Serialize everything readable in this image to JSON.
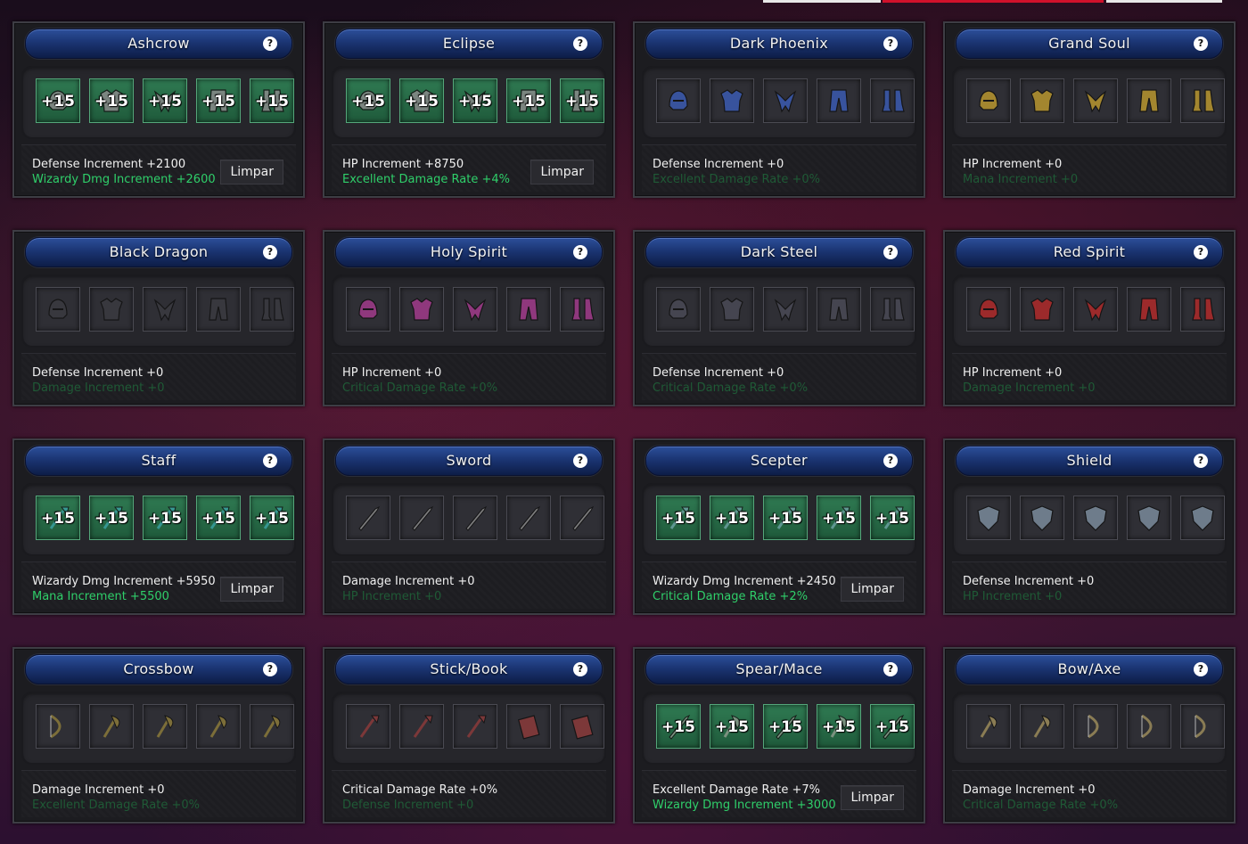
{
  "cards": [
    {
      "title": "Ashcrow",
      "active": true,
      "stat1": "Defense Increment +2100",
      "stat2": "Wizardy Dmg Increment +2600",
      "button": "Limpar",
      "level": "+15",
      "items": [
        "helm",
        "armor",
        "gloves",
        "pants",
        "boots"
      ],
      "color": "#8a8a8a"
    },
    {
      "title": "Eclipse",
      "active": true,
      "stat1": "HP Increment +8750",
      "stat2": "Excellent Damage Rate +4%",
      "button": "Limpar",
      "level": "+15",
      "items": [
        "helm",
        "armor",
        "gloves",
        "pants",
        "boots"
      ],
      "color": "#8a8a8a"
    },
    {
      "title": "Dark Phoenix",
      "active": false,
      "stat1": "Defense Increment +0",
      "stat2": "Excellent Damage Rate +0%",
      "button": "",
      "level": "",
      "items": [
        "helm",
        "armor",
        "gloves",
        "pants",
        "boots"
      ],
      "color": "#3a5ab0"
    },
    {
      "title": "Grand Soul",
      "active": false,
      "stat1": "HP Increment +0",
      "stat2": "Mana Increment +0",
      "button": "",
      "level": "",
      "items": [
        "helm",
        "armor",
        "gloves",
        "pants",
        "boots"
      ],
      "color": "#b8962e"
    },
    {
      "title": "Black Dragon",
      "active": false,
      "stat1": "Defense Increment +0",
      "stat2": "Damage Increment +0",
      "button": "",
      "level": "",
      "items": [
        "helm",
        "armor",
        "gloves",
        "pants",
        "boots"
      ],
      "color": "#3a3a40"
    },
    {
      "title": "Holy Spirit",
      "active": false,
      "stat1": "HP Increment +0",
      "stat2": "Critical Damage Rate +0%",
      "button": "",
      "level": "",
      "items": [
        "helm",
        "armor",
        "gloves",
        "pants",
        "boots"
      ],
      "color": "#a03a8a"
    },
    {
      "title": "Dark Steel",
      "active": false,
      "stat1": "Defense Increment +0",
      "stat2": "Critical Damage Rate +0%",
      "button": "",
      "level": "",
      "items": [
        "helm",
        "armor",
        "gloves",
        "pants",
        "boots"
      ],
      "color": "#4a4a55"
    },
    {
      "title": "Red Spirit",
      "active": false,
      "stat1": "HP Increment +0",
      "stat2": "Damage Increment +0",
      "button": "",
      "level": "",
      "items": [
        "helm",
        "armor",
        "gloves",
        "pants",
        "boots"
      ],
      "color": "#b02a2a"
    },
    {
      "title": "Staff",
      "active": true,
      "stat1": "Wizardy Dmg Increment +5950",
      "stat2": "Mana Increment +5500",
      "button": "Limpar",
      "level": "+15",
      "items": [
        "staff",
        "staff",
        "staff",
        "staff",
        "staff"
      ],
      "color": "#3aa0a0"
    },
    {
      "title": "Sword",
      "active": false,
      "stat1": "Damage Increment +0",
      "stat2": "HP Increment +0",
      "button": "",
      "level": "",
      "items": [
        "sword",
        "sword",
        "sword",
        "sword",
        "sword"
      ],
      "color": "#8a8a8a"
    },
    {
      "title": "Scepter",
      "active": true,
      "stat1": "Wizardy Dmg Increment +2450",
      "stat2": "Critical Damage Rate +2%",
      "button": "Limpar",
      "level": "+15",
      "items": [
        "scepter",
        "scepter",
        "scepter",
        "scepter",
        "scepter"
      ],
      "color": "#6aa0a0"
    },
    {
      "title": "Shield",
      "active": false,
      "stat1": "Defense Increment +0",
      "stat2": "HP Increment +0",
      "button": "",
      "level": "",
      "items": [
        "shield",
        "shield",
        "shield",
        "shield",
        "shield"
      ],
      "color": "#7a8a9a"
    },
    {
      "title": "Crossbow",
      "active": false,
      "stat1": "Damage Increment +0",
      "stat2": "Excellent Damage Rate +0%",
      "button": "",
      "level": "",
      "items": [
        "crossbow",
        "axe",
        "mace",
        "hammer",
        "scythe"
      ],
      "color": "#8a7a3a"
    },
    {
      "title": "Stick/Book",
      "active": false,
      "stat1": "Critical Damage Rate +0%",
      "stat2": "Defense Increment +0",
      "button": "",
      "level": "",
      "items": [
        "stick",
        "stick",
        "stick",
        "book",
        "book"
      ],
      "color": "#8a3a3a"
    },
    {
      "title": "Spear/Mace",
      "active": true,
      "stat1": "Excellent Damage Rate +7%",
      "stat2": "Wizardy Dmg Increment +3000",
      "button": "Limpar",
      "level": "+15",
      "items": [
        "spear",
        "mace",
        "spear",
        "scythe",
        "spear"
      ],
      "color": "#8a9a8a"
    },
    {
      "title": "Bow/Axe",
      "active": false,
      "stat1": "Damage Increment +0",
      "stat2": "Critical Damage Rate +0%",
      "button": "",
      "level": "",
      "items": [
        "axe",
        "axe",
        "bow",
        "bow",
        "bow"
      ],
      "color": "#9a8a5a"
    }
  ],
  "help_glyph": "?"
}
